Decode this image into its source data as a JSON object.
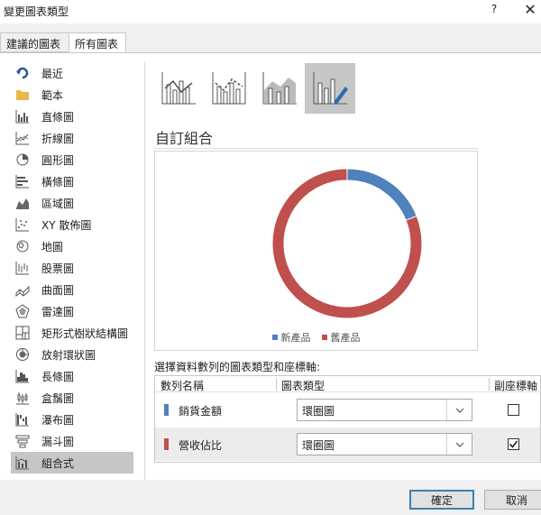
{
  "window": {
    "title": "變更圖表類型",
    "help": "?",
    "close": "✕"
  },
  "tabs": [
    {
      "label": "建議的圖表",
      "active": false
    },
    {
      "label": "所有圖表",
      "active": true
    }
  ],
  "sidebar": {
    "items": [
      {
        "label": "最近",
        "icon": "recent-icon"
      },
      {
        "label": "範本",
        "icon": "folder-icon"
      },
      {
        "label": "直條圖",
        "icon": "column-chart-icon"
      },
      {
        "label": "折線圖",
        "icon": "line-chart-icon"
      },
      {
        "label": "圓形圖",
        "icon": "pie-chart-icon"
      },
      {
        "label": "橫條圖",
        "icon": "bar-chart-icon"
      },
      {
        "label": "區域圖",
        "icon": "area-chart-icon"
      },
      {
        "label": "XY 散佈圖",
        "icon": "scatter-chart-icon"
      },
      {
        "label": "地圖",
        "icon": "map-chart-icon"
      },
      {
        "label": "股票圖",
        "icon": "stock-chart-icon"
      },
      {
        "label": "曲面圖",
        "icon": "surface-chart-icon"
      },
      {
        "label": "雷達圖",
        "icon": "radar-chart-icon"
      },
      {
        "label": "矩形式樹狀結構圖",
        "icon": "treemap-chart-icon"
      },
      {
        "label": "放射環狀圖",
        "icon": "sunburst-chart-icon"
      },
      {
        "label": "長條圖",
        "icon": "histogram-chart-icon"
      },
      {
        "label": "盒鬚圖",
        "icon": "box-whisker-chart-icon"
      },
      {
        "label": "瀑布圖",
        "icon": "waterfall-chart-icon"
      },
      {
        "label": "漏斗圖",
        "icon": "funnel-chart-icon"
      },
      {
        "label": "組合式",
        "icon": "combo-chart-icon",
        "selected": true
      }
    ]
  },
  "combo_types": [
    {
      "name": "clustered-column-line-icon",
      "active": false
    },
    {
      "name": "clustered-column-line-secondary-icon",
      "active": false
    },
    {
      "name": "stacked-area-column-icon",
      "active": false
    },
    {
      "name": "custom-combination-icon",
      "active": true
    }
  ],
  "section_title": "自訂組合",
  "chart_data": {
    "type": "pie",
    "variant": "doughnut",
    "categories": [
      "新產品",
      "舊產品"
    ],
    "values": [
      19,
      81
    ],
    "colors": [
      "#4f81bd",
      "#c0504d"
    ],
    "legend": "bottom"
  },
  "assign": {
    "label": "選擇資料數列的圖表類型和座標軸:",
    "headers": {
      "series": "數列名稱",
      "type": "圖表類型",
      "axis": "副座標軸"
    },
    "rows": [
      {
        "name": "銷貨金額",
        "color": "#4f81bd",
        "type": "環圈圖",
        "secondary": false
      },
      {
        "name": "營收佔比",
        "color": "#c0504d",
        "type": "環圈圖",
        "secondary": true
      }
    ]
  },
  "buttons": {
    "ok": "確定",
    "cancel": "取消"
  },
  "colors": {
    "accent": "#3c7fb1",
    "selected": "#c6c6c6"
  }
}
